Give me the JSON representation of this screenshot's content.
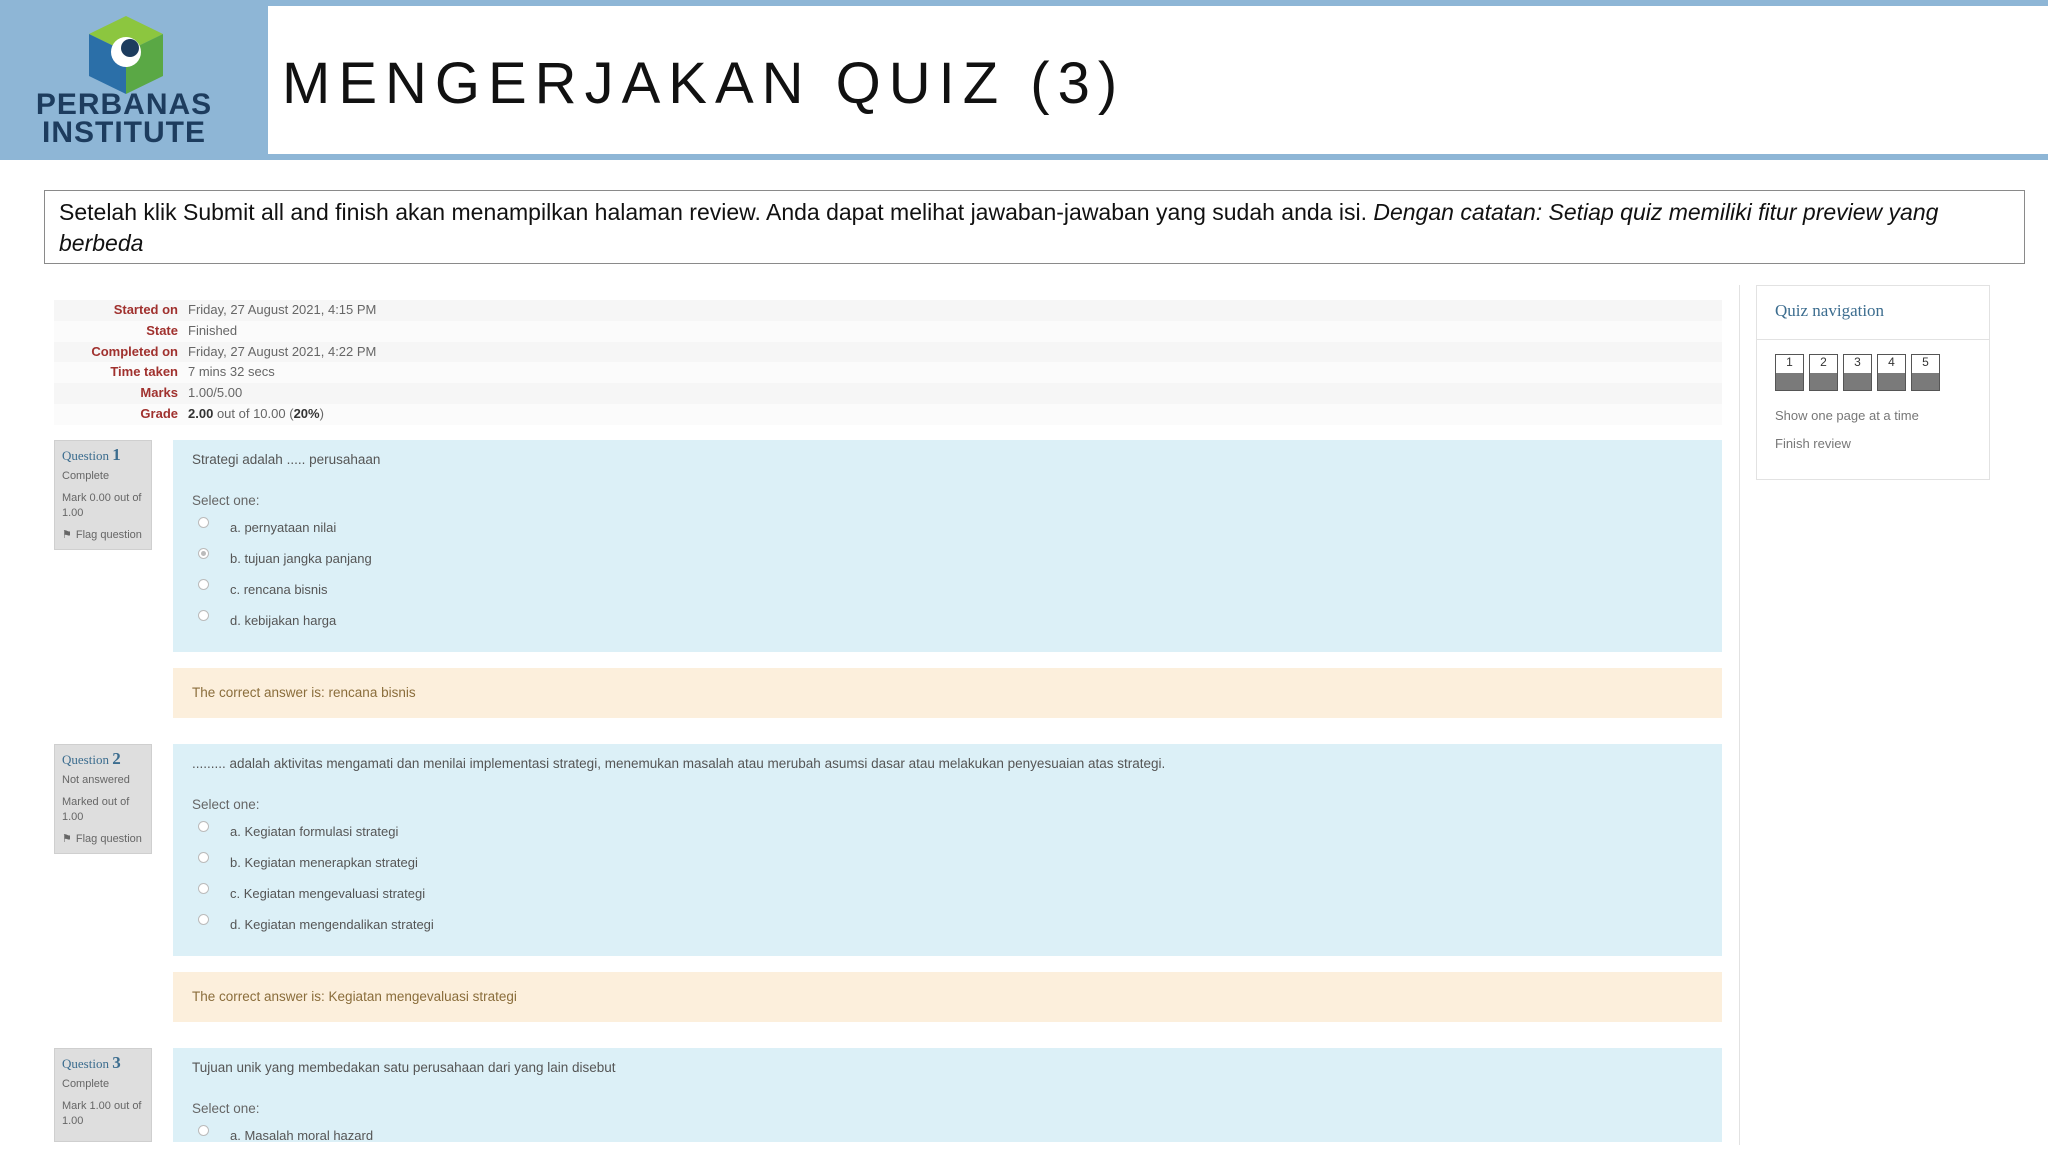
{
  "header": {
    "logo_line1": "PERBANAS",
    "logo_line2": "INSTITUTE",
    "title": "MENGERJAKAN QUIZ (3)"
  },
  "note": {
    "text": "Setelah klik Submit all and finish akan menampilkan halaman review. Anda dapat melihat jawaban-jawaban yang sudah anda isi.",
    "italic": "Dengan catatan: Setiap quiz memiliki fitur preview yang berbeda"
  },
  "summary": {
    "started_label": "Started on",
    "started_value": "Friday, 27 August 2021, 4:15 PM",
    "state_label": "State",
    "state_value": "Finished",
    "completed_label": "Completed on",
    "completed_value": "Friday, 27 August 2021, 4:22 PM",
    "time_label": "Time taken",
    "time_value": "7 mins 32 secs",
    "marks_label": "Marks",
    "marks_value": "1.00/5.00",
    "grade_label": "Grade",
    "grade_score": "2.00",
    "grade_middle": "out of 10.00 (",
    "grade_percent": "20%",
    "grade_end": ")"
  },
  "questions": [
    {
      "label": "Question",
      "number": "1",
      "status": "Complete",
      "mark": "Mark 0.00 out of 1.00",
      "flag": "Flag question",
      "text": "Strategi adalah ..... perusahaan",
      "select": "Select one:",
      "options": [
        "a. pernyataan nilai",
        "b. tujuan jangka panjang",
        "c. rencana bisnis",
        "d. kebijakan harga"
      ],
      "selected_index": 1,
      "feedback": "The correct answer is: rencana bisnis"
    },
    {
      "label": "Question",
      "number": "2",
      "status": "Not answered",
      "mark": "Marked out of 1.00",
      "flag": "Flag question",
      "text": "......... adalah aktivitas mengamati dan menilai implementasi strategi, menemukan masalah atau merubah asumsi dasar atau melakukan penyesuaian atas strategi.",
      "select": "Select one:",
      "options": [
        "a. Kegiatan formulasi strategi",
        "b. Kegiatan menerapkan strategi",
        "c. Kegiatan mengevaluasi strategi",
        "d. Kegiatan mengendalikan strategi"
      ],
      "selected_index": -1,
      "feedback": "The correct answer is: Kegiatan mengevaluasi strategi"
    },
    {
      "label": "Question",
      "number": "3",
      "status": "Complete",
      "mark": "Mark 1.00 out of 1.00",
      "text": "Tujuan unik yang membedakan satu perusahaan dari yang lain disebut",
      "select": "Select one:",
      "options": [
        "a. Masalah moral hazard"
      ]
    }
  ],
  "quiz_nav": {
    "title": "Quiz navigation",
    "buttons": [
      "1",
      "2",
      "3",
      "4",
      "5"
    ],
    "show_one_page": "Show one page at a time",
    "finish_review": "Finish review"
  },
  "icons": {
    "flag": "flag-icon",
    "logo": "cube-logo-icon"
  },
  "colors": {
    "header_blue": "#8eb6d6",
    "question_bg": "#dcf0f7",
    "feedback_bg": "#fcefdc",
    "summary_label": "#a0312e",
    "link_blue": "#3c6d8f"
  }
}
